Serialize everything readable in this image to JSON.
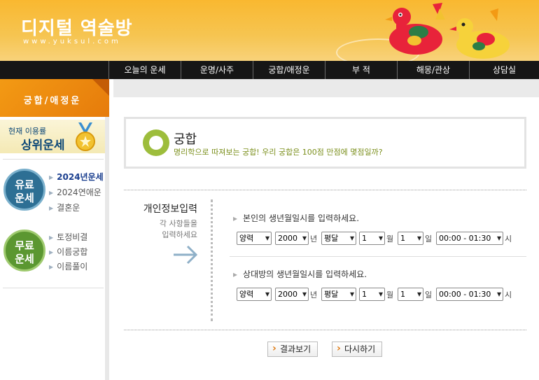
{
  "header": {
    "logo": "디지털 역술방",
    "domain": "www.yuksul.com",
    "colors": {
      "header_bg": "#f6c552",
      "nav_bg": "#161616",
      "accent": "#e67b0b"
    }
  },
  "nav": {
    "items": [
      {
        "label": "오늘의 운세"
      },
      {
        "label": "운명/사주"
      },
      {
        "label": "궁합/애정운"
      },
      {
        "label": "부 적"
      },
      {
        "label": "해몽/관상"
      },
      {
        "label": "상담실"
      }
    ]
  },
  "sidebar": {
    "title": "궁합/애정운",
    "banner_small": "현재 이용률",
    "banner_big": "상위운세",
    "paid": {
      "badge": "유료\n운세",
      "links": [
        {
          "label": "2024년운세",
          "active": true
        },
        {
          "label": "2024연애운"
        },
        {
          "label": "결혼운"
        }
      ]
    },
    "free": {
      "badge": "무료\n운세",
      "links": [
        {
          "label": "토정비결"
        },
        {
          "label": "이름궁합"
        },
        {
          "label": "이름풀이"
        }
      ]
    }
  },
  "main": {
    "title": "궁합",
    "subtitle": "명리학으로 따져보는 궁합! 우리 궁합은 100점 만점에 몇점일까?",
    "form": {
      "heading": "개인정보입력",
      "sub1": "각 사항들을",
      "sub2": "입력하세요",
      "person1_prompt": "본인의 생년월일시를 입력하세요.",
      "person2_prompt": "상대방의 생년월일시를 입력하세요.",
      "calendar": "양력",
      "year": "2000",
      "year_unit": "년",
      "leap": "평달",
      "month": "1",
      "month_unit": "월",
      "day": "1",
      "day_unit": "일",
      "time": "00:00 - 01:30",
      "time_unit": "시"
    },
    "buttons": {
      "result": "결과보기",
      "reset": "다시하기"
    }
  }
}
